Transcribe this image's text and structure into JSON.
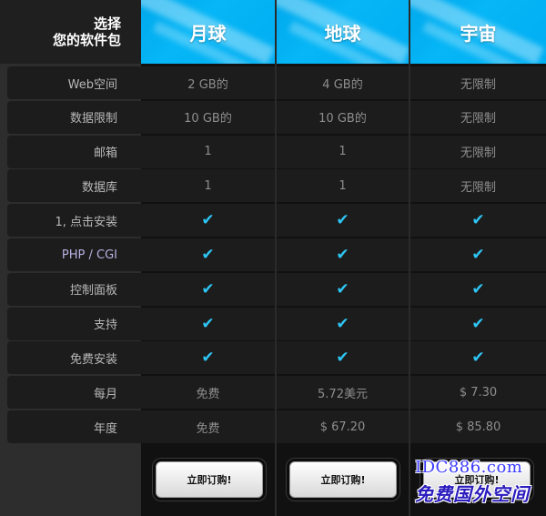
{
  "header": {
    "corner_line1": "选择",
    "corner_line2": "您的软件包"
  },
  "plans": [
    {
      "name": "月球",
      "subscribe_label": "立即订购!"
    },
    {
      "name": "地球",
      "subscribe_label": "立即订购!"
    },
    {
      "name": "宇宙",
      "subscribe_label": "立即订购!"
    }
  ],
  "rows": [
    {
      "label": "Web空间",
      "values": [
        "2 GB的",
        "4 GB的",
        "无限制"
      ]
    },
    {
      "label": "数据限制",
      "values": [
        "10 GB的",
        "10 GB的",
        "无限制"
      ]
    },
    {
      "label": "邮箱",
      "values": [
        "1",
        "1",
        "无限制"
      ]
    },
    {
      "label": "数据库",
      "values": [
        "1",
        "1",
        "无限制"
      ]
    },
    {
      "label": "1, 点击安装",
      "values": [
        "✔",
        "✔",
        "✔"
      ]
    },
    {
      "label": "PHP / CGI",
      "values": [
        "✔",
        "✔",
        "✔"
      ]
    },
    {
      "label": "控制面板",
      "values": [
        "✔",
        "✔",
        "✔"
      ]
    },
    {
      "label": "支持",
      "values": [
        "✔",
        "✔",
        "✔"
      ]
    },
    {
      "label": "免费安装",
      "values": [
        "✔",
        "✔",
        "✔"
      ]
    },
    {
      "label": "每月",
      "values": [
        "免费",
        "5.72美元",
        "$ 7.30"
      ]
    },
    {
      "label": "年度",
      "values": [
        "免费",
        "$ 67.20",
        "$ 85.80"
      ]
    }
  ],
  "watermark": {
    "line1": "IDC886.com",
    "line2": "免费国外空间"
  },
  "colors": {
    "accent": "#00aef2",
    "check": "#2ec6f5"
  }
}
